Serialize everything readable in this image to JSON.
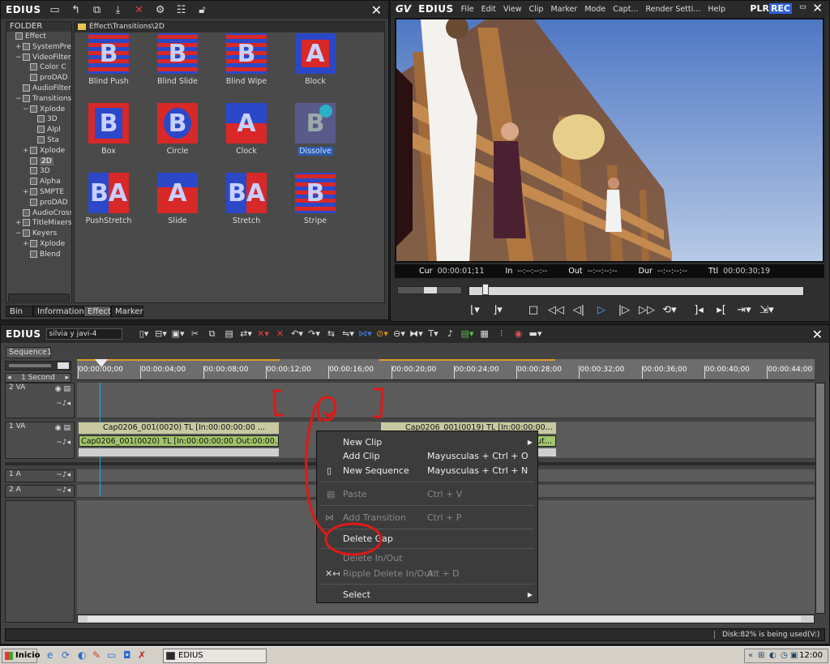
{
  "browser": {
    "app_title": "EDIUS",
    "folder_header": "FOLDER",
    "path": "Effect\\Transitions\\2D",
    "tree": [
      {
        "label": "Effect",
        "indent": 0,
        "pm": ""
      },
      {
        "label": "SystemPres",
        "indent": 1,
        "pm": "+"
      },
      {
        "label": "VideoFilters",
        "indent": 1,
        "pm": "−"
      },
      {
        "label": "Color C",
        "indent": 2,
        "pm": ""
      },
      {
        "label": "proDAD",
        "indent": 2,
        "pm": ""
      },
      {
        "label": "AudioFilters",
        "indent": 1,
        "pm": ""
      },
      {
        "label": "Transitions",
        "indent": 1,
        "pm": "−"
      },
      {
        "label": "Xplode",
        "indent": 2,
        "pm": "−"
      },
      {
        "label": "3D",
        "indent": 3,
        "pm": ""
      },
      {
        "label": "Alpl",
        "indent": 3,
        "pm": ""
      },
      {
        "label": "Sta",
        "indent": 3,
        "pm": ""
      },
      {
        "label": "Xplode",
        "indent": 2,
        "pm": "+"
      },
      {
        "label": "2D",
        "indent": 2,
        "pm": ""
      },
      {
        "label": "3D",
        "indent": 2,
        "pm": ""
      },
      {
        "label": "Alpha",
        "indent": 2,
        "pm": ""
      },
      {
        "label": "SMPTE",
        "indent": 2,
        "pm": "+"
      },
      {
        "label": "proDAD",
        "indent": 2,
        "pm": ""
      },
      {
        "label": "AudioCrossf",
        "indent": 1,
        "pm": ""
      },
      {
        "label": "TitleMixers",
        "indent": 1,
        "pm": "+"
      },
      {
        "label": "Keyers",
        "indent": 1,
        "pm": "−"
      },
      {
        "label": "Xplode",
        "indent": 2,
        "pm": "+"
      },
      {
        "label": "Blend",
        "indent": 2,
        "pm": ""
      }
    ],
    "tiles": [
      {
        "label": "Blind Push",
        "letter": "B",
        "selected": false
      },
      {
        "label": "Blind Slide",
        "letter": "B",
        "selected": false
      },
      {
        "label": "Blind Wipe",
        "letter": "B",
        "selected": false
      },
      {
        "label": "Block",
        "letter": "A",
        "selected": false
      },
      {
        "label": "Box",
        "letter": "B",
        "selected": false
      },
      {
        "label": "Circle",
        "letter": "B",
        "selected": false
      },
      {
        "label": "Clock",
        "letter": "A",
        "selected": false
      },
      {
        "label": "Dissolve",
        "letter": "B",
        "selected": true
      },
      {
        "label": "PushStretch",
        "letter": "BA",
        "selected": false
      },
      {
        "label": "Slide",
        "letter": "A",
        "selected": false
      },
      {
        "label": "Stretch",
        "letter": "BA",
        "selected": false
      },
      {
        "label": "Stripe",
        "letter": "B",
        "selected": false
      }
    ],
    "tabs": [
      "Bin",
      "Information",
      "Effect",
      "Marker"
    ],
    "active_tab": "Effect"
  },
  "player": {
    "app_title": "EDIUS",
    "menu": [
      "File",
      "Edit",
      "View",
      "Clip",
      "Marker",
      "Mode",
      "Capt...",
      "Render Setti...",
      "Help"
    ],
    "mode_plr": "PLR",
    "mode_rec": "REC",
    "timecodes": [
      {
        "label": "Cur",
        "value": "00:00:01;11"
      },
      {
        "label": "In",
        "value": "--:--:--:--"
      },
      {
        "label": "Out",
        "value": "--:--:--:--"
      },
      {
        "label": "Dur",
        "value": "--:--:--:--"
      },
      {
        "label": "Ttl",
        "value": "00:00:30;19"
      }
    ]
  },
  "timeline": {
    "app_title": "EDIUS",
    "sequence_field": "silvia y javi-4",
    "sequence_tab": "Sequence1",
    "scale": "1 Second",
    "ruler_ticks": [
      "00:00:00;00",
      "00:00:04;00",
      "00:00:08;00",
      "00:00:12;00",
      "00:00:16;00",
      "00:00:20;00",
      "00:00:24;00",
      "00:00:28;00",
      "00:00:32;00",
      "00:00:36;00",
      "00:00:40;00",
      "00:00:44;00"
    ],
    "tracks": [
      "2 VA",
      "1 VA",
      "1 A",
      "2 A"
    ],
    "clips": {
      "clip1_top": "Cap0206_001(0020)  TL [In:00:00:00:00 ...",
      "clip1_bottom": "Cap0206_001(0020)  TL [In:00:00:00;00 Out:00:00...",
      "clip2_top": "Cap0206_001(0019)  TL [In:00:00:00...",
      "clip2_bottom": "Out..."
    }
  },
  "context_menu": {
    "new_clip": "New Clip",
    "add_clip": "Add Clip",
    "add_clip_sc": "Mayusculas + Ctrl + O",
    "new_sequence": "New Sequence",
    "new_sequence_sc": "Mayusculas + Ctrl + N",
    "paste": "Paste",
    "paste_sc": "Ctrl + V",
    "add_transition": "Add Transition",
    "add_transition_sc": "Ctrl + P",
    "delete_gap": "Delete Gap",
    "delete_inout": "Delete In/Out",
    "ripple_delete": "Ripple Delete In/Out",
    "ripple_delete_sc": "Alt + D",
    "select": "Select"
  },
  "status": {
    "disk": "Disk:82% is being used(V:)"
  },
  "taskbar": {
    "start": "Inicio",
    "task": "EDIUS",
    "clock": "12:00"
  },
  "colors": {
    "annotation_red": "#e01818",
    "accent_blue": "#5aa7ff",
    "clip_green": "#a3c56a"
  }
}
